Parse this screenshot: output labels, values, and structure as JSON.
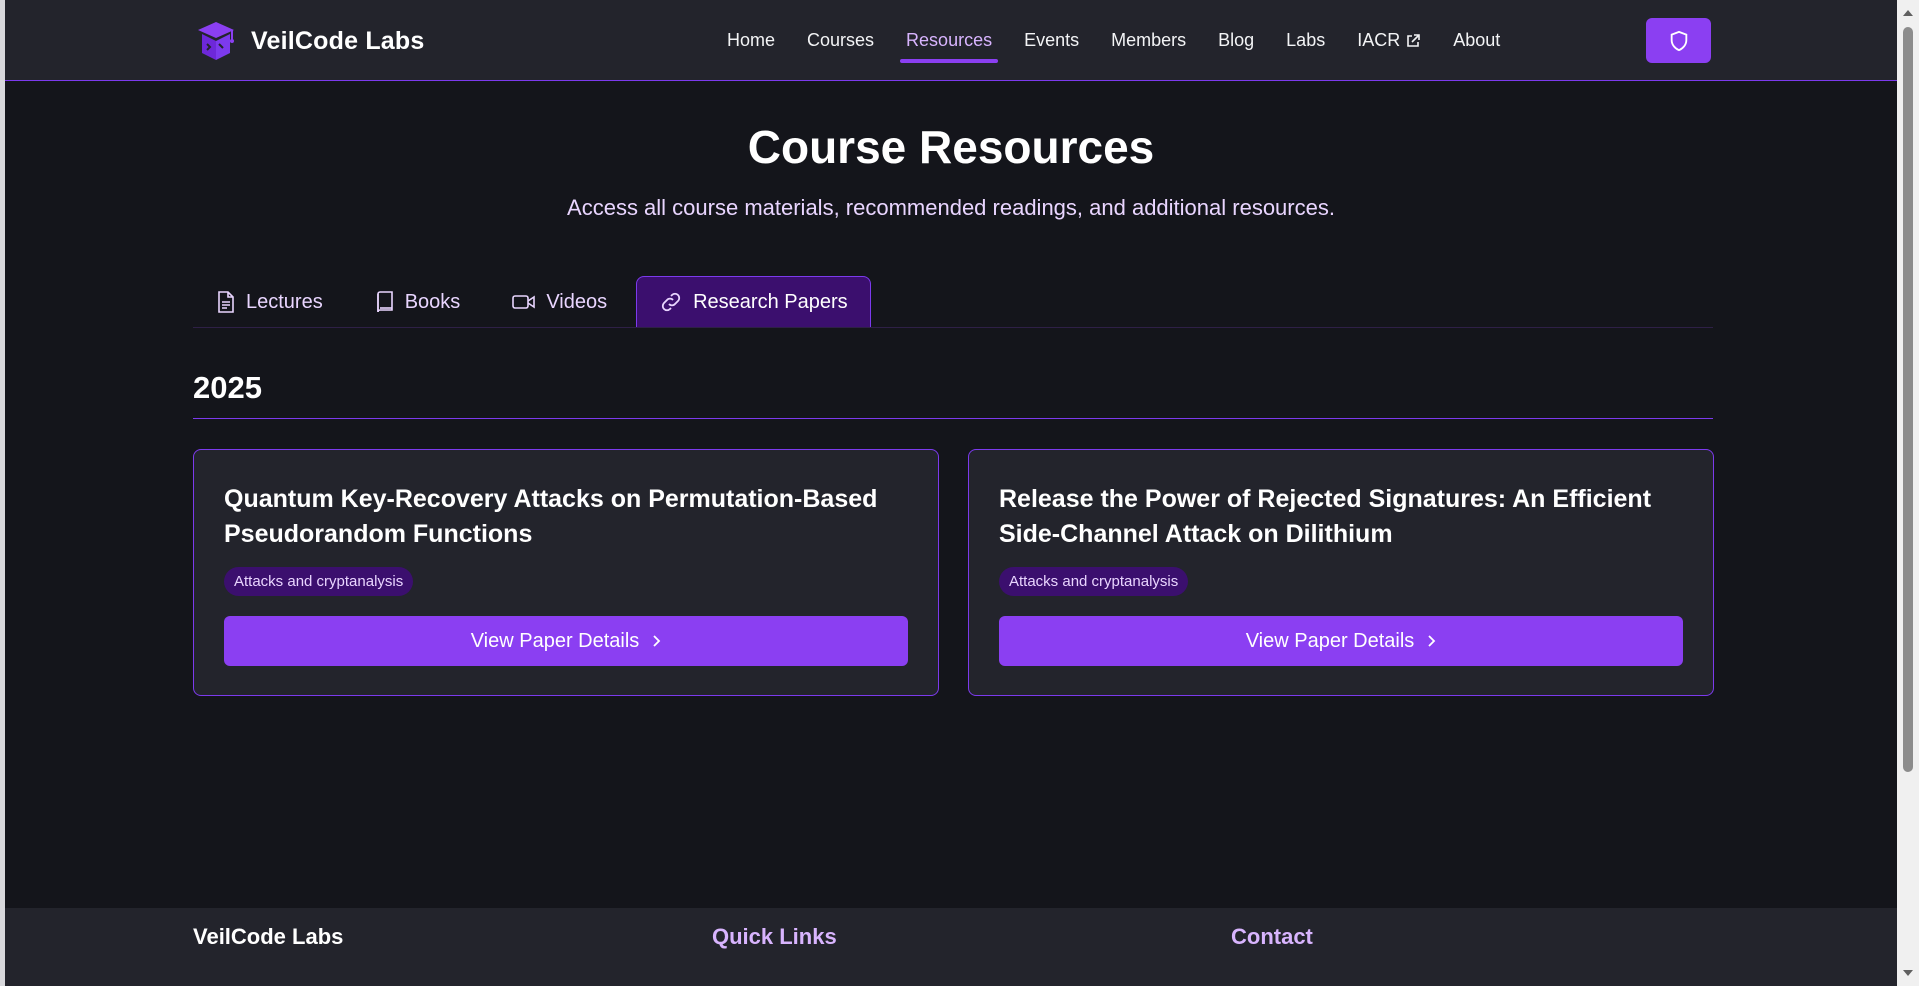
{
  "brand": {
    "name": "VeilCode Labs",
    "logo_icon": "graduation-cube-icon"
  },
  "nav": {
    "items": [
      {
        "label": "Home",
        "active": false
      },
      {
        "label": "Courses",
        "active": false
      },
      {
        "label": "Resources",
        "active": true
      },
      {
        "label": "Events",
        "active": false
      },
      {
        "label": "Members",
        "active": false
      },
      {
        "label": "Blog",
        "active": false
      },
      {
        "label": "Labs",
        "active": false
      },
      {
        "label": "IACR",
        "active": false,
        "icon": "external-link-icon"
      },
      {
        "label": "About",
        "active": false
      }
    ],
    "action_icon": "shield-icon"
  },
  "hero": {
    "title": "Course Resources",
    "subtitle": "Access all course materials, recommended readings, and additional resources."
  },
  "tabs": [
    {
      "label": "Lectures",
      "icon": "document-icon",
      "active": false
    },
    {
      "label": "Books",
      "icon": "book-icon",
      "active": false
    },
    {
      "label": "Videos",
      "icon": "video-icon",
      "active": false
    },
    {
      "label": "Research Papers",
      "icon": "link-icon",
      "active": true
    }
  ],
  "year": "2025",
  "papers": [
    {
      "title": "Quantum Key-Recovery Attacks on Permutation-Based Pseudorandom Functions",
      "tag": "Attacks and cryptanalysis",
      "button_label": "View Paper Details"
    },
    {
      "title": "Release the Power of Rejected Signatures: An Efficient Side-Channel Attack on Dilithium",
      "tag": "Attacks and cryptanalysis",
      "button_label": "View Paper Details"
    }
  ],
  "footer": {
    "columns": [
      {
        "heading": "VeilCode Labs"
      },
      {
        "heading": "Quick Links"
      },
      {
        "heading": "Contact"
      }
    ]
  },
  "colors": {
    "accent": "#8b3ff2",
    "accent_light": "#d8b4fe",
    "background": "#14151b",
    "surface": "#23242c",
    "tag_background": "#3b0f6e"
  }
}
